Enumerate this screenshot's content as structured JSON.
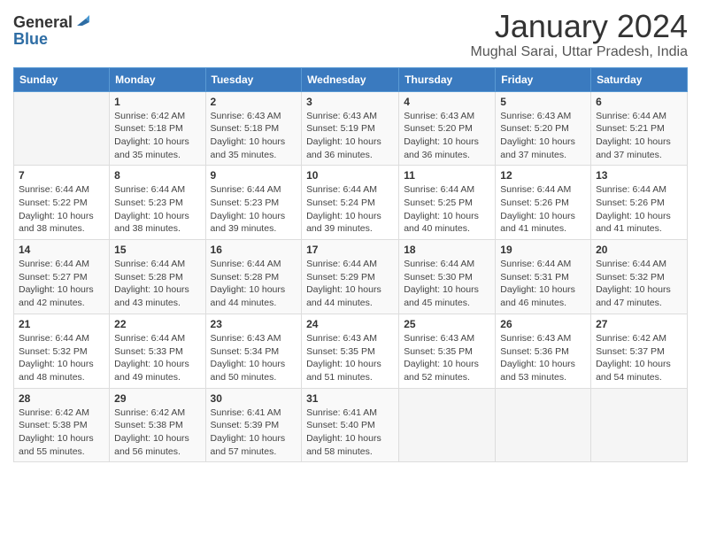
{
  "header": {
    "logo_general": "General",
    "logo_blue": "Blue",
    "title": "January 2024",
    "location": "Mughal Sarai, Uttar Pradesh, India"
  },
  "calendar": {
    "days_of_week": [
      "Sunday",
      "Monday",
      "Tuesday",
      "Wednesday",
      "Thursday",
      "Friday",
      "Saturday"
    ],
    "weeks": [
      [
        {
          "day": "",
          "info": ""
        },
        {
          "day": "1",
          "info": "Sunrise: 6:42 AM\nSunset: 5:18 PM\nDaylight: 10 hours\nand 35 minutes."
        },
        {
          "day": "2",
          "info": "Sunrise: 6:43 AM\nSunset: 5:18 PM\nDaylight: 10 hours\nand 35 minutes."
        },
        {
          "day": "3",
          "info": "Sunrise: 6:43 AM\nSunset: 5:19 PM\nDaylight: 10 hours\nand 36 minutes."
        },
        {
          "day": "4",
          "info": "Sunrise: 6:43 AM\nSunset: 5:20 PM\nDaylight: 10 hours\nand 36 minutes."
        },
        {
          "day": "5",
          "info": "Sunrise: 6:43 AM\nSunset: 5:20 PM\nDaylight: 10 hours\nand 37 minutes."
        },
        {
          "day": "6",
          "info": "Sunrise: 6:44 AM\nSunset: 5:21 PM\nDaylight: 10 hours\nand 37 minutes."
        }
      ],
      [
        {
          "day": "7",
          "info": "Sunrise: 6:44 AM\nSunset: 5:22 PM\nDaylight: 10 hours\nand 38 minutes."
        },
        {
          "day": "8",
          "info": "Sunrise: 6:44 AM\nSunset: 5:23 PM\nDaylight: 10 hours\nand 38 minutes."
        },
        {
          "day": "9",
          "info": "Sunrise: 6:44 AM\nSunset: 5:23 PM\nDaylight: 10 hours\nand 39 minutes."
        },
        {
          "day": "10",
          "info": "Sunrise: 6:44 AM\nSunset: 5:24 PM\nDaylight: 10 hours\nand 39 minutes."
        },
        {
          "day": "11",
          "info": "Sunrise: 6:44 AM\nSunset: 5:25 PM\nDaylight: 10 hours\nand 40 minutes."
        },
        {
          "day": "12",
          "info": "Sunrise: 6:44 AM\nSunset: 5:26 PM\nDaylight: 10 hours\nand 41 minutes."
        },
        {
          "day": "13",
          "info": "Sunrise: 6:44 AM\nSunset: 5:26 PM\nDaylight: 10 hours\nand 41 minutes."
        }
      ],
      [
        {
          "day": "14",
          "info": "Sunrise: 6:44 AM\nSunset: 5:27 PM\nDaylight: 10 hours\nand 42 minutes."
        },
        {
          "day": "15",
          "info": "Sunrise: 6:44 AM\nSunset: 5:28 PM\nDaylight: 10 hours\nand 43 minutes."
        },
        {
          "day": "16",
          "info": "Sunrise: 6:44 AM\nSunset: 5:28 PM\nDaylight: 10 hours\nand 44 minutes."
        },
        {
          "day": "17",
          "info": "Sunrise: 6:44 AM\nSunset: 5:29 PM\nDaylight: 10 hours\nand 44 minutes."
        },
        {
          "day": "18",
          "info": "Sunrise: 6:44 AM\nSunset: 5:30 PM\nDaylight: 10 hours\nand 45 minutes."
        },
        {
          "day": "19",
          "info": "Sunrise: 6:44 AM\nSunset: 5:31 PM\nDaylight: 10 hours\nand 46 minutes."
        },
        {
          "day": "20",
          "info": "Sunrise: 6:44 AM\nSunset: 5:32 PM\nDaylight: 10 hours\nand 47 minutes."
        }
      ],
      [
        {
          "day": "21",
          "info": "Sunrise: 6:44 AM\nSunset: 5:32 PM\nDaylight: 10 hours\nand 48 minutes."
        },
        {
          "day": "22",
          "info": "Sunrise: 6:44 AM\nSunset: 5:33 PM\nDaylight: 10 hours\nand 49 minutes."
        },
        {
          "day": "23",
          "info": "Sunrise: 6:43 AM\nSunset: 5:34 PM\nDaylight: 10 hours\nand 50 minutes."
        },
        {
          "day": "24",
          "info": "Sunrise: 6:43 AM\nSunset: 5:35 PM\nDaylight: 10 hours\nand 51 minutes."
        },
        {
          "day": "25",
          "info": "Sunrise: 6:43 AM\nSunset: 5:35 PM\nDaylight: 10 hours\nand 52 minutes."
        },
        {
          "day": "26",
          "info": "Sunrise: 6:43 AM\nSunset: 5:36 PM\nDaylight: 10 hours\nand 53 minutes."
        },
        {
          "day": "27",
          "info": "Sunrise: 6:42 AM\nSunset: 5:37 PM\nDaylight: 10 hours\nand 54 minutes."
        }
      ],
      [
        {
          "day": "28",
          "info": "Sunrise: 6:42 AM\nSunset: 5:38 PM\nDaylight: 10 hours\nand 55 minutes."
        },
        {
          "day": "29",
          "info": "Sunrise: 6:42 AM\nSunset: 5:38 PM\nDaylight: 10 hours\nand 56 minutes."
        },
        {
          "day": "30",
          "info": "Sunrise: 6:41 AM\nSunset: 5:39 PM\nDaylight: 10 hours\nand 57 minutes."
        },
        {
          "day": "31",
          "info": "Sunrise: 6:41 AM\nSunset: 5:40 PM\nDaylight: 10 hours\nand 58 minutes."
        },
        {
          "day": "",
          "info": ""
        },
        {
          "day": "",
          "info": ""
        },
        {
          "day": "",
          "info": ""
        }
      ]
    ]
  }
}
